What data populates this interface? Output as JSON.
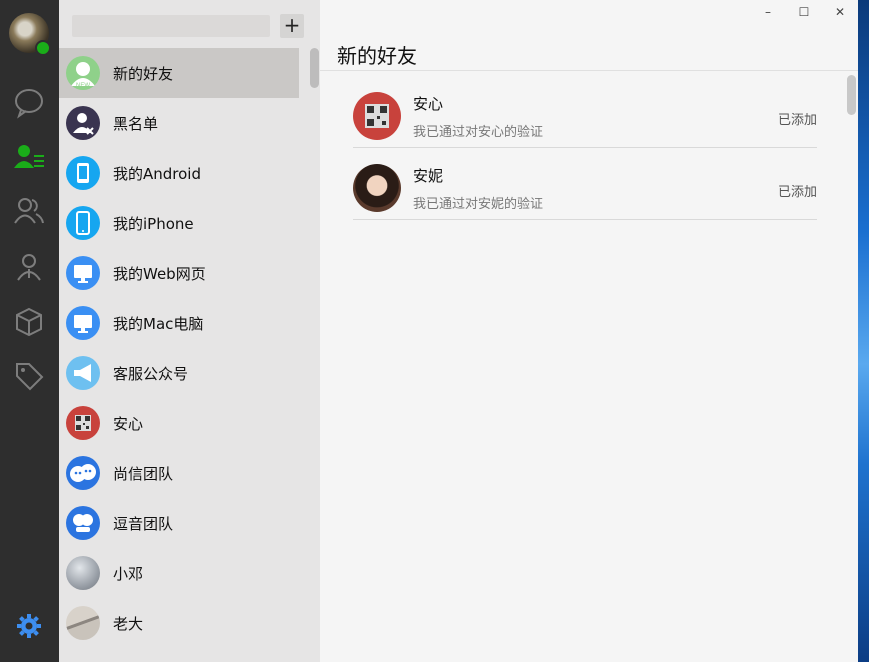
{
  "sidebar": {
    "nav_icons": [
      "chat-bubble-icon",
      "contacts-icon",
      "group-icon",
      "person-icon",
      "box-icon",
      "tag-icon",
      "settings-icon"
    ],
    "accent_color": "#1aad19"
  },
  "contacts": {
    "add_label": "+",
    "items": [
      {
        "name": "新的好友",
        "icon": "new-friend-icon",
        "color": "#8fd18a"
      },
      {
        "name": "黑名单",
        "icon": "blacklist-icon",
        "color": "#3a3450"
      },
      {
        "name": "我的Android",
        "icon": "android-phone-icon",
        "color": "#16a6f0"
      },
      {
        "name": "我的iPhone",
        "icon": "iphone-icon",
        "color": "#16a6f0"
      },
      {
        "name": "我的Web网页",
        "icon": "web-monitor-icon",
        "color": "#3a8ff3"
      },
      {
        "name": "我的Mac电脑",
        "icon": "mac-monitor-icon",
        "color": "#3a8ff3"
      },
      {
        "name": "客服公众号",
        "icon": "megaphone-icon",
        "color": "#6ec0f0"
      },
      {
        "name": "安心",
        "icon": "qrcode-avatar-icon",
        "color": "#c8423c"
      },
      {
        "name": "尚信团队",
        "icon": "chat-faces-icon",
        "color": "#2b74e0"
      },
      {
        "name": "逗音团队",
        "icon": "chat-faces-icon",
        "color": "#2b74e0"
      },
      {
        "name": "小邓",
        "icon": "photo-avatar-icon",
        "color": "#9aa0a8"
      },
      {
        "name": "老大",
        "icon": "photo-avatar-icon",
        "color": "#8c8680"
      }
    ]
  },
  "main": {
    "title": "新的好友",
    "requests": [
      {
        "name": "安心",
        "message": "我已通过对安心的验证",
        "status": "已添加"
      },
      {
        "name": "安妮",
        "message": "我已通过对安妮的验证",
        "status": "已添加"
      }
    ]
  },
  "window_controls": {
    "minimize": "–",
    "maximize": "☐",
    "close": "✕"
  }
}
